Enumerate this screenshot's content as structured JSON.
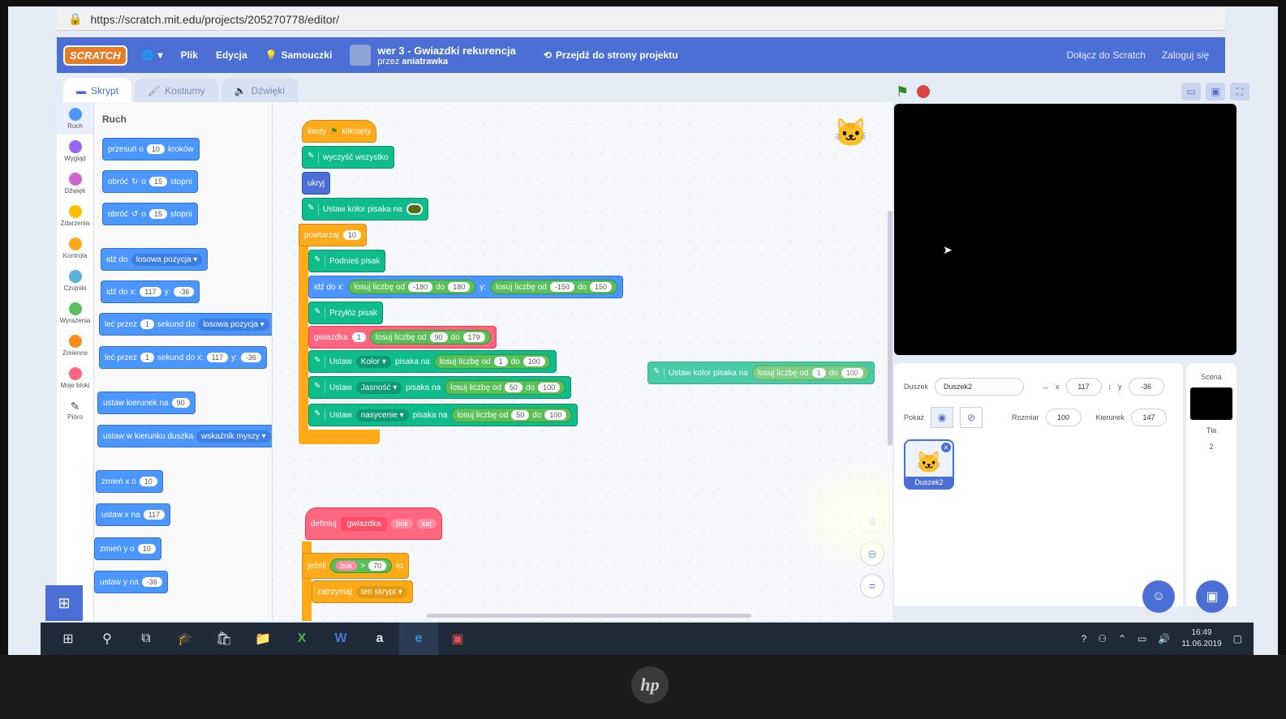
{
  "browser": {
    "url": "https://scratch.mit.edu/projects/205270778/editor/"
  },
  "menubar": {
    "logo": "SCRATCH",
    "file": "Plik",
    "edit": "Edycja",
    "tutorials": "Samouczki",
    "project_title": "wer 3 - Gwiazdki rekurencja",
    "project_author_prefix": "przez",
    "project_author": "aniatrawka",
    "see_project_page": "Przejdź do strony projektu",
    "join": "Dołącz do Scratch",
    "signin": "Zaloguj się"
  },
  "tabs": [
    "Skrypt",
    "Kostiumy",
    "Dźwięki"
  ],
  "categories": [
    {
      "label": "Ruch",
      "color": "#4c97ff"
    },
    {
      "label": "Wygląd",
      "color": "#9966ff"
    },
    {
      "label": "Dźwięk",
      "color": "#cf63cf"
    },
    {
      "label": "Zdarzenia",
      "color": "#ffbf00"
    },
    {
      "label": "Kontrola",
      "color": "#ffab19"
    },
    {
      "label": "Czujniki",
      "color": "#5cb1d6"
    },
    {
      "label": "Wyrażenia",
      "color": "#59c059"
    },
    {
      "label": "Zmienne",
      "color": "#ff8c1a"
    },
    {
      "label": "Moje bloki",
      "color": "#ff6680"
    },
    {
      "label": "Pióro",
      "color": "#0fbd8c"
    }
  ],
  "palette": {
    "title": "Ruch",
    "move": {
      "a": "przesuń o",
      "v": "10",
      "b": "kroków"
    },
    "turn_right": {
      "a": "obróć",
      "b": "o",
      "v": "15",
      "c": "stopni"
    },
    "turn_left": {
      "a": "obróć",
      "b": "o",
      "v": "15",
      "c": "stopni"
    },
    "goto": {
      "a": "idź do",
      "dd": "losowa pozycja"
    },
    "goto_xy": {
      "a": "idź do x:",
      "x": "117",
      "b": "y:",
      "y": "-36"
    },
    "glide": {
      "a": "leć przez",
      "v": "1",
      "b": "sekund do",
      "dd": "losowa pozycja"
    },
    "glide_xy": {
      "a": "leć przez",
      "v": "1",
      "b": "sekund do x:",
      "x": "117",
      "c": "y:",
      "y": "-36"
    },
    "point_dir": {
      "a": "ustaw kierunek na",
      "v": "90"
    },
    "point_towards": {
      "a": "ustaw w kierunku duszka",
      "dd": "wskaźnik myszy"
    },
    "change_x": {
      "a": "zmień x o",
      "v": "10"
    },
    "set_x": {
      "a": "ustaw x na",
      "v": "117"
    },
    "change_y": {
      "a": "zmień y o",
      "v": "10"
    },
    "set_y": {
      "a": "ustaw y na",
      "v": "-36"
    }
  },
  "script": {
    "when_flag": {
      "a": "kiedy",
      "b": "kliknięty"
    },
    "clear": "wyczyść wszystko",
    "hide": "ukryj",
    "set_pen_color": "Ustaw kolor pisaka na",
    "pen_color_swatch": "#556b14",
    "repeat": {
      "a": "powtarzaj",
      "v": "10"
    },
    "pen_up": "Podnieś pisak",
    "goto_rand": {
      "a": "idź do x:",
      "r1": "losuj liczbę od",
      "v1": "-180",
      "d1": "do",
      "v2": "180",
      "b": "y:",
      "r2": "losuj liczbę od",
      "v3": "-150",
      "d2": "do",
      "v4": "150"
    },
    "pen_down": "Przyłóż pisak",
    "star": {
      "a": "gwiazdka",
      "v": "1",
      "r": "losuj liczbę od",
      "v1": "90",
      "d": "do",
      "v2": "179"
    },
    "set_color": {
      "a": "Ustaw",
      "dd": "Kolor",
      "b": "pisaka na",
      "r": "losuj liczbę od",
      "v1": "1",
      "d": "do",
      "v2": "100"
    },
    "set_bright": {
      "a": "Ustaw",
      "dd": "Jasność",
      "b": "pisaka na",
      "r": "losuj liczbę od",
      "v1": "50",
      "d": "do",
      "v2": "100"
    },
    "set_sat": {
      "a": "Ustaw",
      "dd": "nasycenie",
      "b": "pisaka na",
      "r": "losuj liczbę od",
      "v1": "50",
      "d": "do",
      "v2": "100"
    },
    "loose": {
      "a": "Ustaw kolor pisaka na",
      "r": "losuj liczbę od",
      "v1": "1",
      "d": "do",
      "v2": "100"
    },
    "define": {
      "a": "definiuj",
      "b": "gwiazdka",
      "p1": "bok",
      "p2": "kat"
    },
    "if": {
      "a": "jeżeli",
      "p": "bok",
      "op": ">",
      "v": "70",
      "b": "to"
    },
    "stop": {
      "a": "zatrzymaj",
      "dd": "ten skrypt"
    }
  },
  "sprite_info": {
    "sprite_label": "Duszek",
    "sprite_name": "Duszek2",
    "x_label": "x",
    "x": "117",
    "y_label": "y",
    "y": "-36",
    "show_label": "Pokaż",
    "size_label": "Rozmiar",
    "size": "100",
    "direction_label": "Kierunek",
    "direction": "147",
    "thumb_label": "Duszek2"
  },
  "stage_pane": {
    "title": "Scena",
    "backdrops_label": "Tła",
    "backdrops": "2"
  },
  "taskbar": {
    "time": "16:49",
    "date": "11.06.2019"
  },
  "brand": "hp"
}
